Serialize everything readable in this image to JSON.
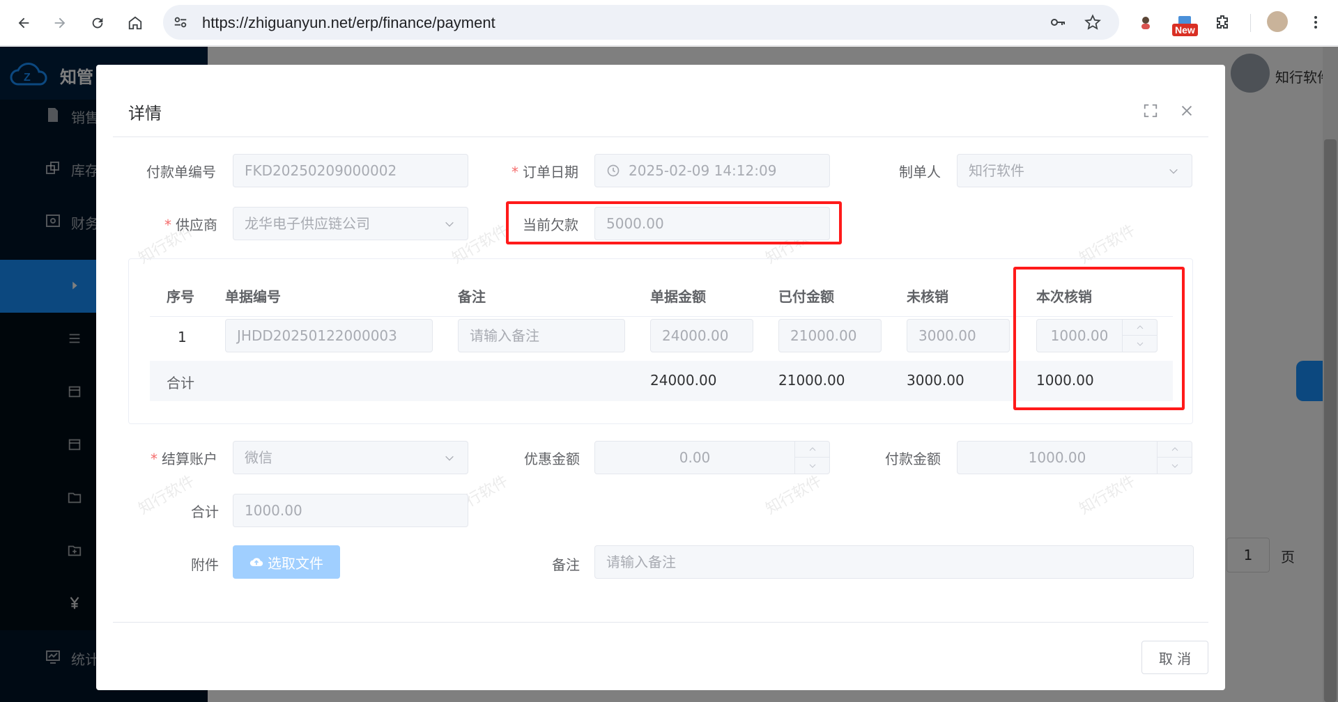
{
  "browser": {
    "url": "https://zhiguanyun.net/erp/finance/payment",
    "new_badge": "New"
  },
  "app": {
    "logo_text": "知管",
    "user_name": "知行软件",
    "sidebar": {
      "items": [
        {
          "label": "销售",
          "icon": "file-icon"
        },
        {
          "label": "库存",
          "icon": "copy-icon"
        },
        {
          "label": "财务",
          "icon": "wallet-icon"
        },
        {
          "label": "统计",
          "icon": "chart-icon"
        }
      ]
    },
    "pagination": {
      "page": "1",
      "suffix": "页"
    }
  },
  "dialog": {
    "title": "详情",
    "form": {
      "payment_no_label": "付款单编号",
      "payment_no": "FKD20250209000002",
      "order_date_label": "订单日期",
      "order_date": "2025-02-09 14:12:09",
      "creator_label": "制单人",
      "creator": "知行软件",
      "supplier_label": "供应商",
      "supplier": "龙华电子供应链公司",
      "current_debt_label": "当前欠款",
      "current_debt": "5000.00",
      "account_label": "结算账户",
      "account": "微信",
      "discount_label": "优惠金额",
      "discount": "0.00",
      "pay_amount_label": "付款金额",
      "pay_amount": "1000.00",
      "total_label": "合计",
      "total": "1000.00",
      "attachment_label": "附件",
      "upload_label": "选取文件",
      "remark_label": "备注",
      "remark_placeholder": "请输入备注"
    },
    "table": {
      "headers": {
        "index": "序号",
        "bill_no": "单据编号",
        "remark": "备注",
        "bill_amount": "单据金额",
        "paid_amount": "已付金额",
        "unverified": "未核销",
        "this_verify": "本次核销"
      },
      "rows": [
        {
          "index": "1",
          "bill_no": "JHDD20250122000003",
          "remark_placeholder": "请输入备注",
          "bill_amount": "24000.00",
          "paid_amount": "21000.00",
          "unverified": "3000.00",
          "this_verify": "1000.00"
        }
      ],
      "summary": {
        "label": "合计",
        "bill_amount": "24000.00",
        "paid_amount": "21000.00",
        "unverified": "3000.00",
        "this_verify": "1000.00"
      }
    },
    "cancel_label": "取 消",
    "watermark": "知行软件",
    "highlight_color": "#ff1a1a"
  }
}
